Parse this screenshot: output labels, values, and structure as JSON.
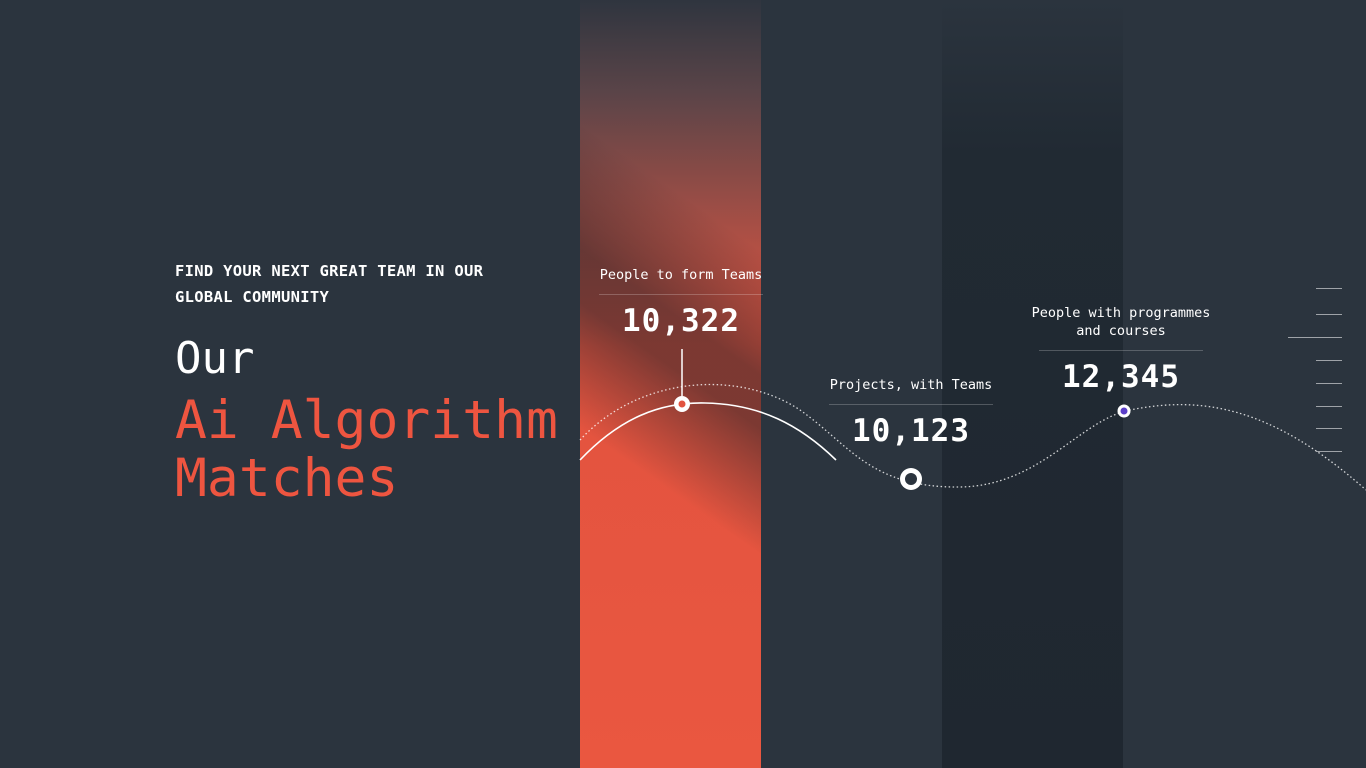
{
  "hero": {
    "eyebrow": "FIND YOUR NEXT GREAT TEAM IN OUR GLOBAL COMMUNITY",
    "title_line1": "Our",
    "title_line2": "Ai Algorithm",
    "title_line3": "Matches"
  },
  "stats": [
    {
      "label": "People to form Teams",
      "value": "10,322"
    },
    {
      "label": "Projects, with Teams",
      "value": "10,123"
    },
    {
      "label": "People with programmes and courses",
      "value": "12,345"
    }
  ],
  "colors": {
    "background": "#2b343e",
    "accent": "#ee5540",
    "marker_dot": "#5b3ec8"
  },
  "icons": [
    "scale-tick-icon"
  ]
}
